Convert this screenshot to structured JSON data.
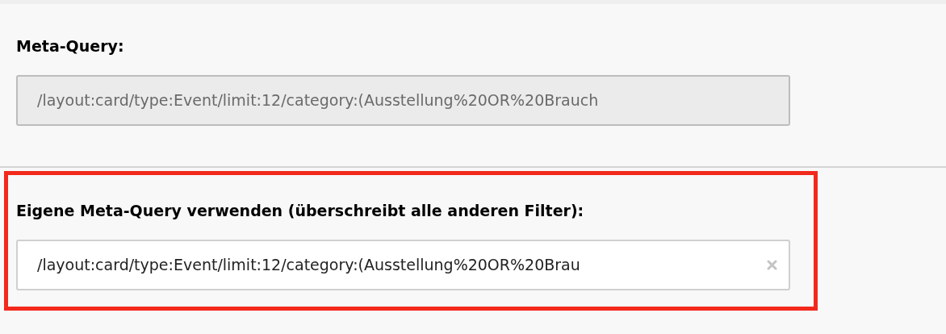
{
  "fields": [
    {
      "label": "Meta-Query:",
      "value": "/layout:card/type:Event/limit:12/category:(Ausstellung%20OR%20Brauch",
      "disabled": true,
      "clearable": false,
      "highlighted": false
    },
    {
      "label": "Eigene Meta-Query verwenden (überschreibt alle anderen Filter):",
      "value": "/layout:card/type:Event/limit:12/category:(Ausstellung%20OR%20Brau",
      "disabled": false,
      "clearable": true,
      "highlighted": true
    }
  ]
}
